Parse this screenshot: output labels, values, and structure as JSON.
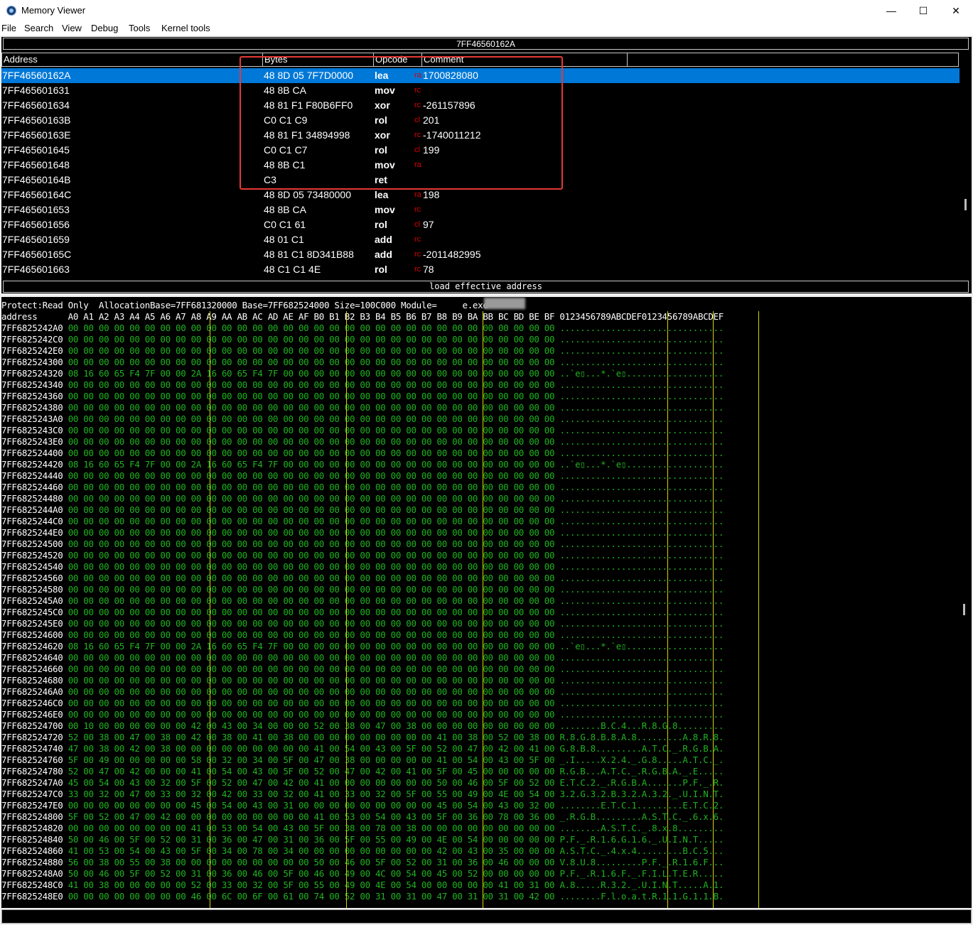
{
  "window": {
    "title": "Memory Viewer",
    "buttons": {
      "minimize": "—",
      "maximize": "☐",
      "close": "✕"
    }
  },
  "menu": [
    "File",
    "Search",
    "View",
    "Debug",
    "Tools",
    "Kernel tools"
  ],
  "disassembler": {
    "address_bar": "7FF46560162A",
    "columns": [
      "Address",
      "Bytes",
      "Opcode",
      "Comment"
    ],
    "selected_index": 0,
    "rows": [
      {
        "address": "7FF46560162A",
        "bytes": "48 8D 05 7F7D0000",
        "opcode": "lea",
        "reg": "ra",
        "comment": "1700828080"
      },
      {
        "address": "7FF465601631",
        "bytes": "48 8B CA",
        "opcode": "mov",
        "reg": "rc",
        "comment": ""
      },
      {
        "address": "7FF465601634",
        "bytes": "48 81 F1 F80B6FF0",
        "opcode": "xor",
        "reg": "rc",
        "comment": "-261157896"
      },
      {
        "address": "7FF46560163B",
        "bytes": "C0 C1 C9",
        "opcode": "rol",
        "reg": "cl",
        "comment": "201"
      },
      {
        "address": "7FF46560163E",
        "bytes": "48 81 F1 34894998",
        "opcode": "xor",
        "reg": "rc",
        "comment": "-1740011212"
      },
      {
        "address": "7FF465601645",
        "bytes": "C0 C1 C7",
        "opcode": "rol",
        "reg": "cl",
        "comment": "199"
      },
      {
        "address": "7FF465601648",
        "bytes": "48 8B C1",
        "opcode": "mov",
        "reg": "ra",
        "comment": ""
      },
      {
        "address": "7FF46560164B",
        "bytes": "C3",
        "opcode": "ret",
        "reg": "",
        "comment": ""
      },
      {
        "address": "7FF46560164C",
        "bytes": "48 8D 05 73480000",
        "opcode": "lea",
        "reg": "ra",
        "comment": "198"
      },
      {
        "address": "7FF465601653",
        "bytes": "48 8B CA",
        "opcode": "mov",
        "reg": "rc",
        "comment": ""
      },
      {
        "address": "7FF465601656",
        "bytes": "C0 C1 61",
        "opcode": "rol",
        "reg": "cl",
        "comment": "97"
      },
      {
        "address": "7FF465601659",
        "bytes": "48 01 C1",
        "opcode": "add",
        "reg": "rc",
        "comment": ""
      },
      {
        "address": "7FF46560165C",
        "bytes": "48 81 C1 8D341B88",
        "opcode": "add",
        "reg": "rc",
        "comment": "-2011482995"
      },
      {
        "address": "7FF465601663",
        "bytes": "48 C1 C1 4E",
        "opcode": "rol",
        "reg": "rc",
        "comment": "78"
      }
    ],
    "status_text": "load effective address"
  },
  "hexview": {
    "info": "Protect:Read Only  AllocationBase=7FF681320000 Base=7FF682524000 Size=100C000 Module=",
    "module_suffix": "e.exe",
    "header": "address      A0 A1 A2 A3 A4 A5 A6 A7 A8 A9 AA AB AC AD AE AF B0 B1 B2 B3 B4 B5 B6 B7 B8 B9 BA BB BC BD BE BF 0123456789ABCDEF0123456789ABCDEF",
    "rows": [
      {
        "address": "7FF6825242A0",
        "bytes": "00 00 00 00 00 00 00 00 00 00 00 00 00 00 00 00 00 00 00 00 00 00 00 00 00 00 00 00 00 00 00 00",
        "ascii": "................................"
      },
      {
        "address": "7FF6825242C0",
        "bytes": "00 00 00 00 00 00 00 00 00 00 00 00 00 00 00 00 00 00 00 00 00 00 00 00 00 00 00 00 00 00 00 00",
        "ascii": "................................"
      },
      {
        "address": "7FF6825242E0",
        "bytes": "00 00 00 00 00 00 00 00 00 00 00 00 00 00 00 00 00 00 00 00 00 00 00 00 00 00 00 00 00 00 00 00",
        "ascii": "................................"
      },
      {
        "address": "7FF682524300",
        "bytes": "00 00 00 00 00 00 00 00 00 00 00 00 00 00 00 00 00 00 00 00 00 00 00 00 00 00 00 00 00 00 00 00",
        "ascii": "................................"
      },
      {
        "address": "7FF682524320",
        "bytes": "08 16 60 65 F4 7F 00 00 2A 16 60 65 F4 7F 00 00 00 00 00 00 00 00 00 00 00 00 00 00 00 00 00 00",
        "ascii": "..`e▯...*.`e▯..................."
      },
      {
        "address": "7FF682524340",
        "bytes": "00 00 00 00 00 00 00 00 00 00 00 00 00 00 00 00 00 00 00 00 00 00 00 00 00 00 00 00 00 00 00 00",
        "ascii": "................................"
      },
      {
        "address": "7FF682524360",
        "bytes": "00 00 00 00 00 00 00 00 00 00 00 00 00 00 00 00 00 00 00 00 00 00 00 00 00 00 00 00 00 00 00 00",
        "ascii": "................................"
      },
      {
        "address": "7FF682524380",
        "bytes": "00 00 00 00 00 00 00 00 00 00 00 00 00 00 00 00 00 00 00 00 00 00 00 00 00 00 00 00 00 00 00 00",
        "ascii": "................................"
      },
      {
        "address": "7FF6825243A0",
        "bytes": "00 00 00 00 00 00 00 00 00 00 00 00 00 00 00 00 00 00 00 00 00 00 00 00 00 00 00 00 00 00 00 00",
        "ascii": "................................"
      },
      {
        "address": "7FF6825243C0",
        "bytes": "00 00 00 00 00 00 00 00 00 00 00 00 00 00 00 00 00 00 00 00 00 00 00 00 00 00 00 00 00 00 00 00",
        "ascii": "................................"
      },
      {
        "address": "7FF6825243E0",
        "bytes": "00 00 00 00 00 00 00 00 00 00 00 00 00 00 00 00 00 00 00 00 00 00 00 00 00 00 00 00 00 00 00 00",
        "ascii": "................................"
      },
      {
        "address": "7FF682524400",
        "bytes": "00 00 00 00 00 00 00 00 00 00 00 00 00 00 00 00 00 00 00 00 00 00 00 00 00 00 00 00 00 00 00 00",
        "ascii": "................................"
      },
      {
        "address": "7FF682524420",
        "bytes": "08 16 60 65 F4 7F 00 00 2A 16 60 65 F4 7F 00 00 00 00 00 00 00 00 00 00 00 00 00 00 00 00 00 00",
        "ascii": "..`e▯...*.`e▯..................."
      },
      {
        "address": "7FF682524440",
        "bytes": "00 00 00 00 00 00 00 00 00 00 00 00 00 00 00 00 00 00 00 00 00 00 00 00 00 00 00 00 00 00 00 00",
        "ascii": "................................"
      },
      {
        "address": "7FF682524460",
        "bytes": "00 00 00 00 00 00 00 00 00 00 00 00 00 00 00 00 00 00 00 00 00 00 00 00 00 00 00 00 00 00 00 00",
        "ascii": "................................"
      },
      {
        "address": "7FF682524480",
        "bytes": "00 00 00 00 00 00 00 00 00 00 00 00 00 00 00 00 00 00 00 00 00 00 00 00 00 00 00 00 00 00 00 00",
        "ascii": "................................"
      },
      {
        "address": "7FF6825244A0",
        "bytes": "00 00 00 00 00 00 00 00 00 00 00 00 00 00 00 00 00 00 00 00 00 00 00 00 00 00 00 00 00 00 00 00",
        "ascii": "................................"
      },
      {
        "address": "7FF6825244C0",
        "bytes": "00 00 00 00 00 00 00 00 00 00 00 00 00 00 00 00 00 00 00 00 00 00 00 00 00 00 00 00 00 00 00 00",
        "ascii": "................................"
      },
      {
        "address": "7FF6825244E0",
        "bytes": "00 00 00 00 00 00 00 00 00 00 00 00 00 00 00 00 00 00 00 00 00 00 00 00 00 00 00 00 00 00 00 00",
        "ascii": "................................"
      },
      {
        "address": "7FF682524500",
        "bytes": "00 00 00 00 00 00 00 00 00 00 00 00 00 00 00 00 00 00 00 00 00 00 00 00 00 00 00 00 00 00 00 00",
        "ascii": "................................"
      },
      {
        "address": "7FF682524520",
        "bytes": "00 00 00 00 00 00 00 00 00 00 00 00 00 00 00 00 00 00 00 00 00 00 00 00 00 00 00 00 00 00 00 00",
        "ascii": "................................"
      },
      {
        "address": "7FF682524540",
        "bytes": "00 00 00 00 00 00 00 00 00 00 00 00 00 00 00 00 00 00 00 00 00 00 00 00 00 00 00 00 00 00 00 00",
        "ascii": "................................"
      },
      {
        "address": "7FF682524560",
        "bytes": "00 00 00 00 00 00 00 00 00 00 00 00 00 00 00 00 00 00 00 00 00 00 00 00 00 00 00 00 00 00 00 00",
        "ascii": "................................"
      },
      {
        "address": "7FF682524580",
        "bytes": "00 00 00 00 00 00 00 00 00 00 00 00 00 00 00 00 00 00 00 00 00 00 00 00 00 00 00 00 00 00 00 00",
        "ascii": "................................"
      },
      {
        "address": "7FF6825245A0",
        "bytes": "00 00 00 00 00 00 00 00 00 00 00 00 00 00 00 00 00 00 00 00 00 00 00 00 00 00 00 00 00 00 00 00",
        "ascii": "................................"
      },
      {
        "address": "7FF6825245C0",
        "bytes": "00 00 00 00 00 00 00 00 00 00 00 00 00 00 00 00 00 00 00 00 00 00 00 00 00 00 00 00 00 00 00 00",
        "ascii": "................................"
      },
      {
        "address": "7FF6825245E0",
        "bytes": "00 00 00 00 00 00 00 00 00 00 00 00 00 00 00 00 00 00 00 00 00 00 00 00 00 00 00 00 00 00 00 00",
        "ascii": "................................"
      },
      {
        "address": "7FF682524600",
        "bytes": "00 00 00 00 00 00 00 00 00 00 00 00 00 00 00 00 00 00 00 00 00 00 00 00 00 00 00 00 00 00 00 00",
        "ascii": "................................"
      },
      {
        "address": "7FF682524620",
        "bytes": "08 16 60 65 F4 7F 00 00 2A 16 60 65 F4 7F 00 00 00 00 00 00 00 00 00 00 00 00 00 00 00 00 00 00",
        "ascii": "..`e▯...*.`e▯..................."
      },
      {
        "address": "7FF682524640",
        "bytes": "00 00 00 00 00 00 00 00 00 00 00 00 00 00 00 00 00 00 00 00 00 00 00 00 00 00 00 00 00 00 00 00",
        "ascii": "................................"
      },
      {
        "address": "7FF682524660",
        "bytes": "00 00 00 00 00 00 00 00 00 00 00 00 00 00 00 00 00 00 00 00 00 00 00 00 00 00 00 00 00 00 00 00",
        "ascii": "................................"
      },
      {
        "address": "7FF682524680",
        "bytes": "00 00 00 00 00 00 00 00 00 00 00 00 00 00 00 00 00 00 00 00 00 00 00 00 00 00 00 00 00 00 00 00",
        "ascii": "................................"
      },
      {
        "address": "7FF6825246A0",
        "bytes": "00 00 00 00 00 00 00 00 00 00 00 00 00 00 00 00 00 00 00 00 00 00 00 00 00 00 00 00 00 00 00 00",
        "ascii": "................................"
      },
      {
        "address": "7FF6825246C0",
        "bytes": "00 00 00 00 00 00 00 00 00 00 00 00 00 00 00 00 00 00 00 00 00 00 00 00 00 00 00 00 00 00 00 00",
        "ascii": "................................"
      },
      {
        "address": "7FF6825246E0",
        "bytes": "00 00 00 00 00 00 00 00 00 00 00 00 00 00 00 00 00 00 00 00 00 00 00 00 00 00 00 00 00 00 00 00",
        "ascii": "................................"
      },
      {
        "address": "7FF682524700",
        "bytes": "00 10 00 00 00 00 00 00 42 00 43 00 34 00 00 00 52 00 38 00 47 00 38 00 00 00 00 00 00 00 00 00",
        "ascii": "........B.C.4...R.8.G.8........."
      },
      {
        "address": "7FF682524720",
        "bytes": "52 00 38 00 47 00 38 00 42 00 38 00 41 00 38 00 00 00 00 00 00 00 00 00 41 00 38 00 52 00 38 00",
        "ascii": "R.8.G.8.B.8.A.8.........A.8.R.8."
      },
      {
        "address": "7FF682524740",
        "bytes": "47 00 38 00 42 00 38 00 00 00 00 00 00 00 00 00 41 00 54 00 43 00 5F 00 52 00 47 00 42 00 41 00",
        "ascii": "G.8.B.8.........A.T.C._.R.G.B.A."
      },
      {
        "address": "7FF682524760",
        "bytes": "5F 00 49 00 00 00 00 00 58 00 32 00 34 00 5F 00 47 00 38 00 00 00 00 00 41 00 54 00 43 00 5F 00",
        "ascii": "_.I.....X.2.4._.G.8.....A.T.C._."
      },
      {
        "address": "7FF682524780",
        "bytes": "52 00 47 00 42 00 00 00 41 00 54 00 43 00 5F 00 52 00 47 00 42 00 41 00 5F 00 45 00 00 00 00 00",
        "ascii": "R.G.B...A.T.C._.R.G.B.A._.E....."
      },
      {
        "address": "7FF6825247A0",
        "bytes": "45 00 54 00 43 00 32 00 5F 00 52 00 47 00 42 00 41 00 00 00 00 00 00 00 50 00 46 00 5F 00 52 00",
        "ascii": "E.T.C.2._.R.G.B.A.......P.F._.R."
      },
      {
        "address": "7FF6825247C0",
        "bytes": "33 00 32 00 47 00 33 00 32 00 42 00 33 00 32 00 41 00 33 00 32 00 5F 00 55 00 49 00 4E 00 54 00",
        "ascii": "3.2.G.3.2.B.3.2.A.3.2._.U.I.N.T."
      },
      {
        "address": "7FF6825247E0",
        "bytes": "00 00 00 00 00 00 00 00 45 00 54 00 43 00 31 00 00 00 00 00 00 00 00 00 45 00 54 00 43 00 32 00",
        "ascii": "........E.T.C.1.........E.T.C.2."
      },
      {
        "address": "7FF682524800",
        "bytes": "5F 00 52 00 47 00 42 00 00 00 00 00 00 00 00 00 41 00 53 00 54 00 43 00 5F 00 36 00 78 00 36 00",
        "ascii": "_.R.G.B.........A.S.T.C._.6.x.6."
      },
      {
        "address": "7FF682524820",
        "bytes": "00 00 00 00 00 00 00 00 41 00 53 00 54 00 43 00 5F 00 38 00 78 00 38 00 00 00 00 00 00 00 00 00",
        "ascii": "........A.S.T.C._.8.x.8........."
      },
      {
        "address": "7FF682524840",
        "bytes": "50 00 46 00 5F 00 52 00 31 00 36 00 47 00 31 00 36 00 5F 00 55 00 49 00 4E 00 54 00 00 00 00 00",
        "ascii": "P.F._.R.1.6.G.1.6._.U.I.N.T....."
      },
      {
        "address": "7FF682524860",
        "bytes": "41 00 53 00 54 00 43 00 5F 00 34 00 78 00 34 00 00 00 00 00 00 00 00 00 42 00 43 00 35 00 00 00",
        "ascii": "A.S.T.C._.4.x.4.........B.C.5..."
      },
      {
        "address": "7FF682524880",
        "bytes": "56 00 38 00 55 00 38 00 00 00 00 00 00 00 00 00 50 00 46 00 5F 00 52 00 31 00 36 00 46 00 00 00",
        "ascii": "V.8.U.8.........P.F._.R.1.6.F..."
      },
      {
        "address": "7FF6825248A0",
        "bytes": "50 00 46 00 5F 00 52 00 31 00 36 00 46 00 5F 00 46 00 49 00 4C 00 54 00 45 00 52 00 00 00 00 00",
        "ascii": "P.F._.R.1.6.F._.F.I.L.T.E.R....."
      },
      {
        "address": "7FF6825248C0",
        "bytes": "41 00 38 00 00 00 00 00 52 00 33 00 32 00 5F 00 55 00 49 00 4E 00 54 00 00 00 00 00 41 00 31 00",
        "ascii": "A.8.....R.3.2._.U.I.N.T.....A.1."
      },
      {
        "address": "7FF6825248E0",
        "bytes": "00 00 00 00 00 00 00 00 46 00 6C 00 6F 00 61 00 74 00 52 00 31 00 31 00 47 00 31 00 31 00 42 00",
        "ascii": "........F.l.o.a.t.R.1.1.G.1.1.B."
      }
    ]
  },
  "colors": {
    "hex_text": "#1fb31f",
    "address_text": "#ffffff",
    "separator": "#d4d400",
    "selection": "#0078d7",
    "register_text": "#e00000",
    "annotation_box": "#e53935"
  }
}
